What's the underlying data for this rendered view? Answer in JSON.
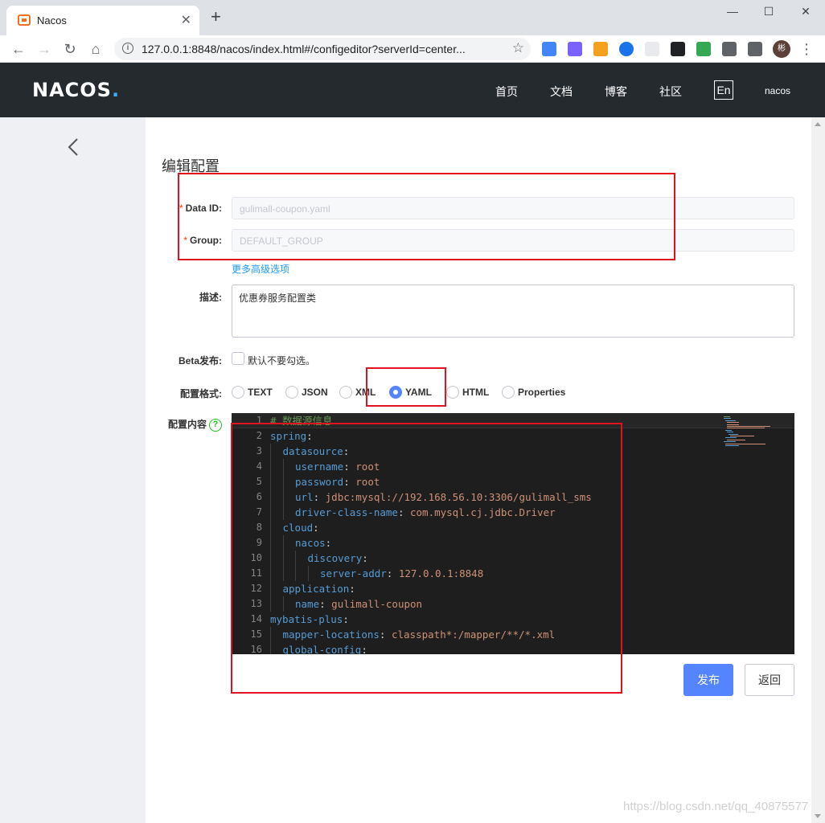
{
  "browser": {
    "tab_title": "Nacos",
    "tab_close": "✕",
    "new_tab": "+",
    "url": "127.0.0.1:8848/nacos/index.html#/configeditor?serverId=center...",
    "window_controls": [
      "—",
      "☐",
      "✕"
    ],
    "profile_initial": "彬"
  },
  "header": {
    "logo": "NACOS",
    "logo_dot": ".",
    "nav": [
      "首页",
      "文档",
      "博客",
      "社区"
    ],
    "lang": "En",
    "user": "nacos"
  },
  "page": {
    "title": "编辑配置"
  },
  "form": {
    "data_id_label": "Data ID:",
    "data_id_value": "gulimall-coupon.yaml",
    "group_label": "Group:",
    "group_value": "DEFAULT_GROUP",
    "required_mark": "*",
    "advanced_link": "更多高级选项",
    "desc_label": "描述:",
    "desc_value": "优惠券服务配置类",
    "beta_label": "Beta发布:",
    "beta_text": "默认不要勾选。",
    "format_label": "配置格式:",
    "formats": [
      "TEXT",
      "JSON",
      "XML",
      "YAML",
      "HTML",
      "Properties"
    ],
    "selected_format": "YAML",
    "content_label": "配置内容",
    "help": "?"
  },
  "editor": {
    "lines": [
      {
        "n": "1",
        "indent": 0,
        "comment": "# 数据源信息"
      },
      {
        "n": "2",
        "indent": 0,
        "key": "spring",
        "value": ""
      },
      {
        "n": "3",
        "indent": 1,
        "key": "datasource",
        "value": ""
      },
      {
        "n": "4",
        "indent": 2,
        "key": "username",
        "value": "root"
      },
      {
        "n": "5",
        "indent": 2,
        "key": "password",
        "value": "root"
      },
      {
        "n": "6",
        "indent": 2,
        "key": "url",
        "value": "jdbc:mysql://192.168.56.10:3306/gulimall_sms"
      },
      {
        "n": "7",
        "indent": 2,
        "key": "driver-class-name",
        "value": "com.mysql.cj.jdbc.Driver"
      },
      {
        "n": "8",
        "indent": 1,
        "key": "cloud",
        "value": ""
      },
      {
        "n": "9",
        "indent": 2,
        "key": "nacos",
        "value": ""
      },
      {
        "n": "10",
        "indent": 3,
        "key": "discovery",
        "value": ""
      },
      {
        "n": "11",
        "indent": 4,
        "key": "server-addr",
        "value": "127.0.0.1:8848"
      },
      {
        "n": "12",
        "indent": 1,
        "key": "application",
        "value": ""
      },
      {
        "n": "13",
        "indent": 2,
        "key": "name",
        "value": "gulimall-coupon"
      },
      {
        "n": "14",
        "indent": 0,
        "key": "mybatis-plus",
        "value": ""
      },
      {
        "n": "15",
        "indent": 1,
        "key": "mapper-locations",
        "value": "classpath*:/mapper/**/*.xml"
      },
      {
        "n": "16",
        "indent": 1,
        "key": "global-config",
        "value": ""
      }
    ]
  },
  "actions": {
    "publish": "发布",
    "return": "返回"
  },
  "watermark": "https://blog.csdn.net/qq_40875577",
  "colors": {
    "header_bg": "#252a2f",
    "primary": "#5584ff",
    "annotation": "#e0141e",
    "editor_bg": "#1e1e1e"
  }
}
